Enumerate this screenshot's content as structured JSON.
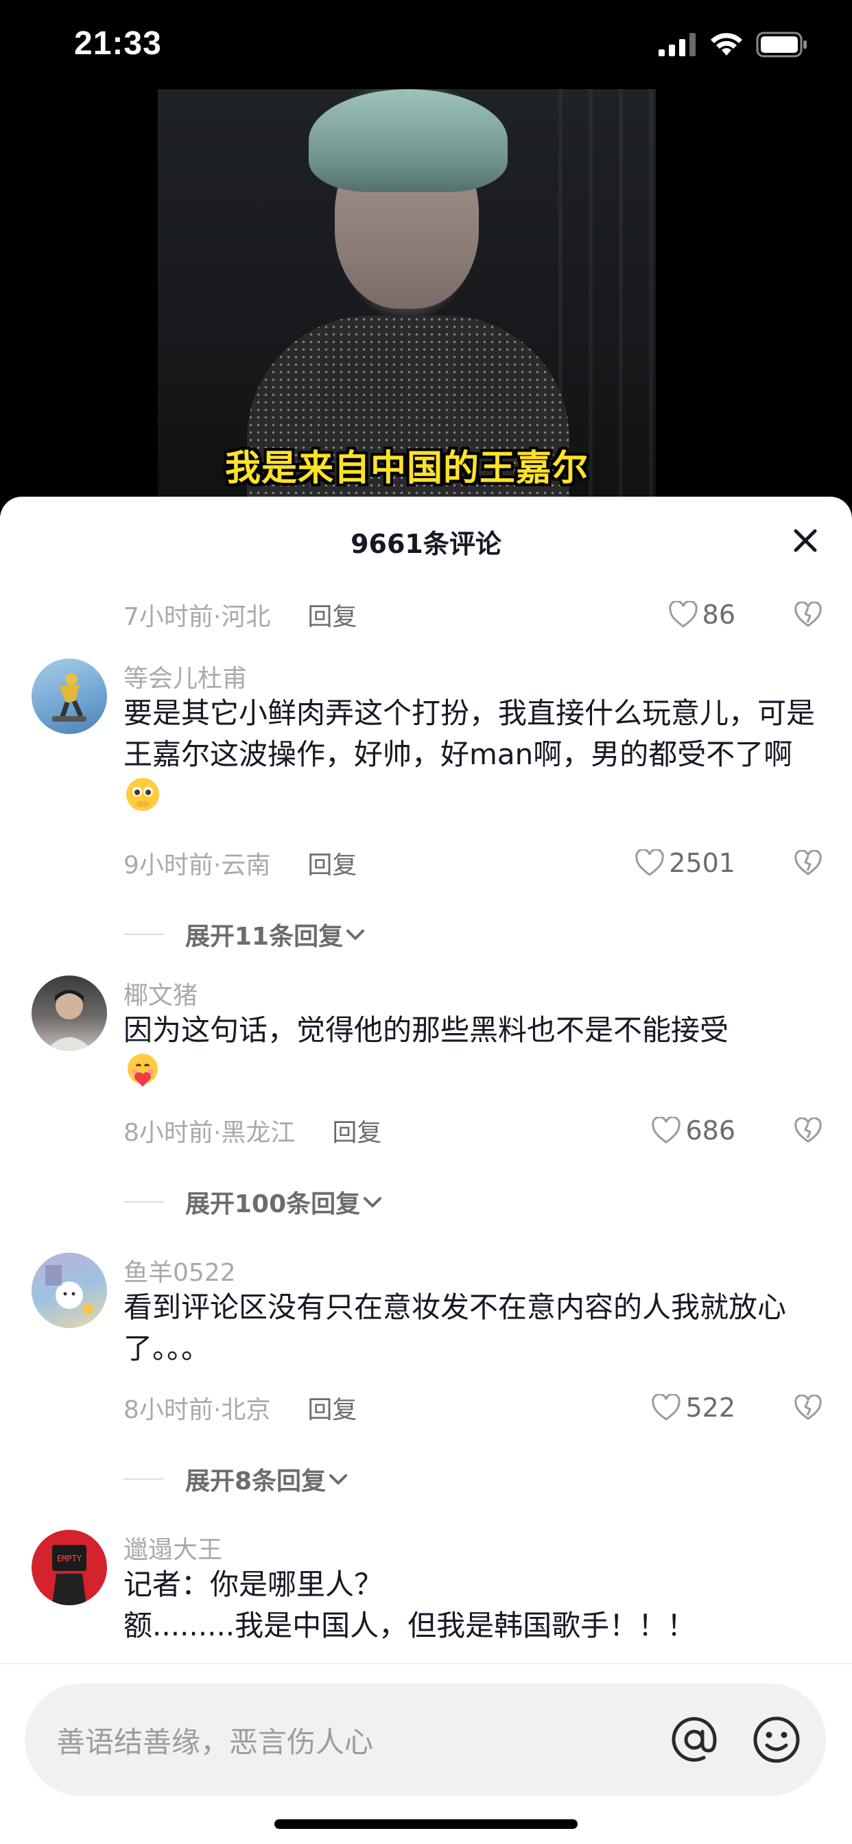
{
  "status_bar": {
    "time": "21:33"
  },
  "video": {
    "caption": "我是来自中国的王嘉尔"
  },
  "sheet": {
    "title": "9661条评论"
  },
  "top_partial": {
    "meta": "7小时前·河北",
    "reply": "回复",
    "likes": "86"
  },
  "comments": [
    {
      "user": "等会儿杜甫",
      "text": "要是其它小鲜肉弄这个打扮，我直接什么玩意儿，可是王嘉尔这波操作，好帅，好man啊，男的都受不了啊",
      "emoji": "pleading-face-emoji",
      "meta": "9小时前·云南",
      "reply": "回复",
      "likes": "2501",
      "expand": "展开11条回复"
    },
    {
      "user": "椰文猪",
      "text": "因为这句话，觉得他的那些黑料也不是不能接受",
      "emoji": "hugging-heart-emoji",
      "meta": "8小时前·黑龙江",
      "reply": "回复",
      "likes": "686",
      "expand": "展开100条回复"
    },
    {
      "user": "鱼羊0522",
      "text": "看到评论区没有只在意妆发不在意内容的人我就放心了。。。",
      "meta": "8小时前·北京",
      "reply": "回复",
      "likes": "522",
      "expand": "展开8条回复"
    },
    {
      "user": "邋遢大王",
      "text_line1": "记者：你是哪里人？",
      "text_line2": "额.........我是中国人，但我是韩国歌手！！！",
      "avatar_text": "EMPTY"
    }
  ],
  "input": {
    "placeholder": "善语结善缘，恶言伤人心"
  }
}
